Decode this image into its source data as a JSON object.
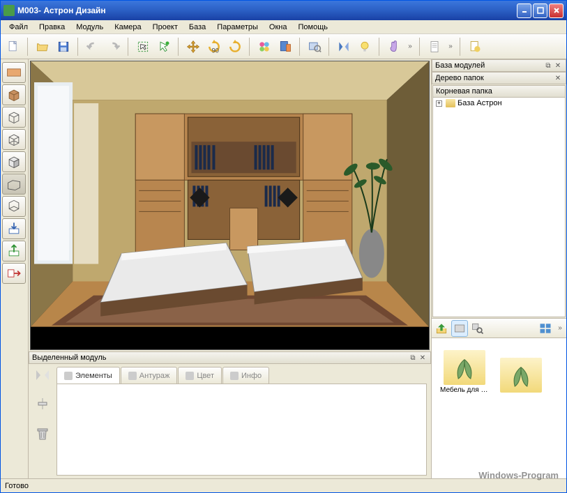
{
  "window": {
    "title": "М003- Астрон Дизайн"
  },
  "menus": [
    "Файл",
    "Правка",
    "Модуль",
    "Камера",
    "Проект",
    "База",
    "Параметры",
    "Окна",
    "Помощь"
  ],
  "right_panel": {
    "module_base_title": "База модулей",
    "folder_tree_title": "Дерево папок",
    "root_folder": "Корневая папка",
    "tree_items": [
      {
        "label": "База Астрон"
      }
    ],
    "browser_items": [
      {
        "label": "Мебель для д..."
      },
      {
        "label": ""
      }
    ]
  },
  "bottom_panel": {
    "title": "Выделенный модуль",
    "tabs": [
      "Элементы",
      "Антураж",
      "Цвет",
      "Инфо"
    ]
  },
  "status": "Готово",
  "watermark": "Windows-Program"
}
